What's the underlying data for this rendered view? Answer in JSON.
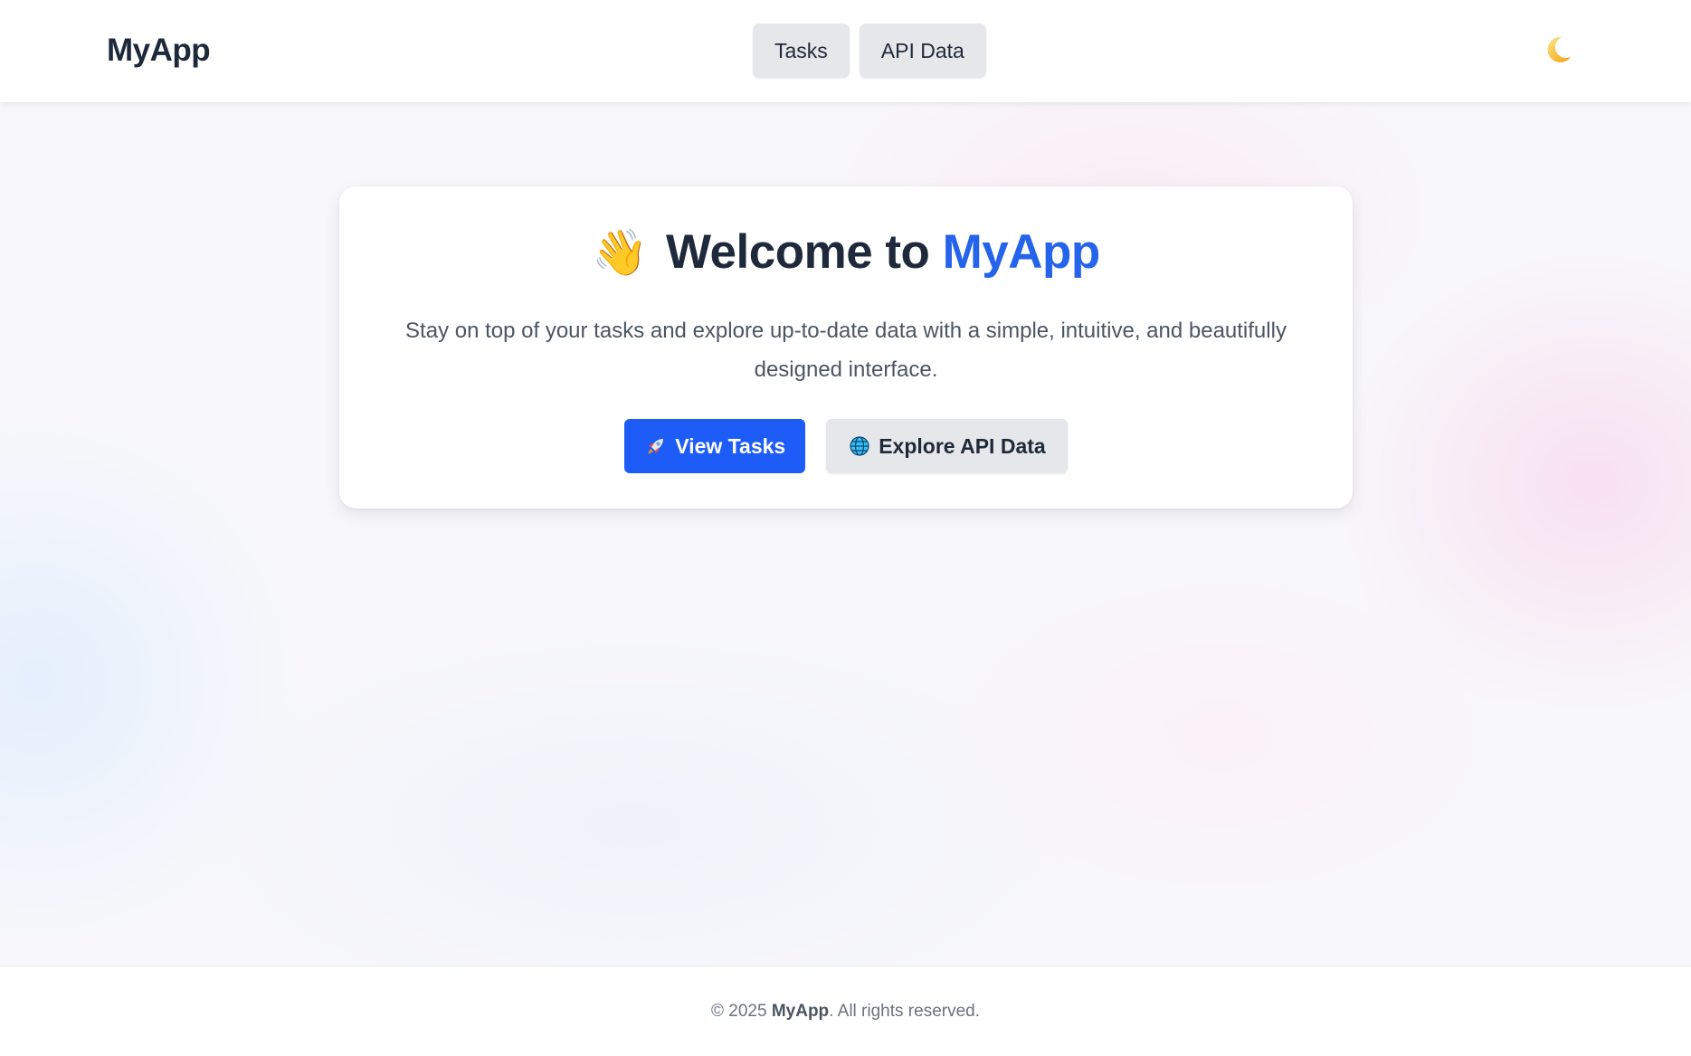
{
  "header": {
    "logo": "MyApp",
    "nav": [
      {
        "label": "Tasks"
      },
      {
        "label": "API Data"
      }
    ],
    "theme_toggle_icon": "moon-icon"
  },
  "hero": {
    "wave_emoji": "👋",
    "title_prefix": "Welcome to",
    "title_brand": "MyApp",
    "description": "Stay on top of your tasks and explore up-to-date data with a simple, intuitive, and beautifully designed interface.",
    "primary_button": {
      "icon": "rocket-icon",
      "label": "View Tasks"
    },
    "secondary_button": {
      "icon": "globe-icon",
      "label": "Explore API Data"
    }
  },
  "footer": {
    "copyright_prefix": "© 2025",
    "brand": "MyApp",
    "copyright_suffix": ". All rights reserved."
  },
  "colors": {
    "brand": "#2563eb",
    "primary_button": "#1d5cf6",
    "secondary_button": "#e5e7eb",
    "text_dark": "#1e293b"
  }
}
